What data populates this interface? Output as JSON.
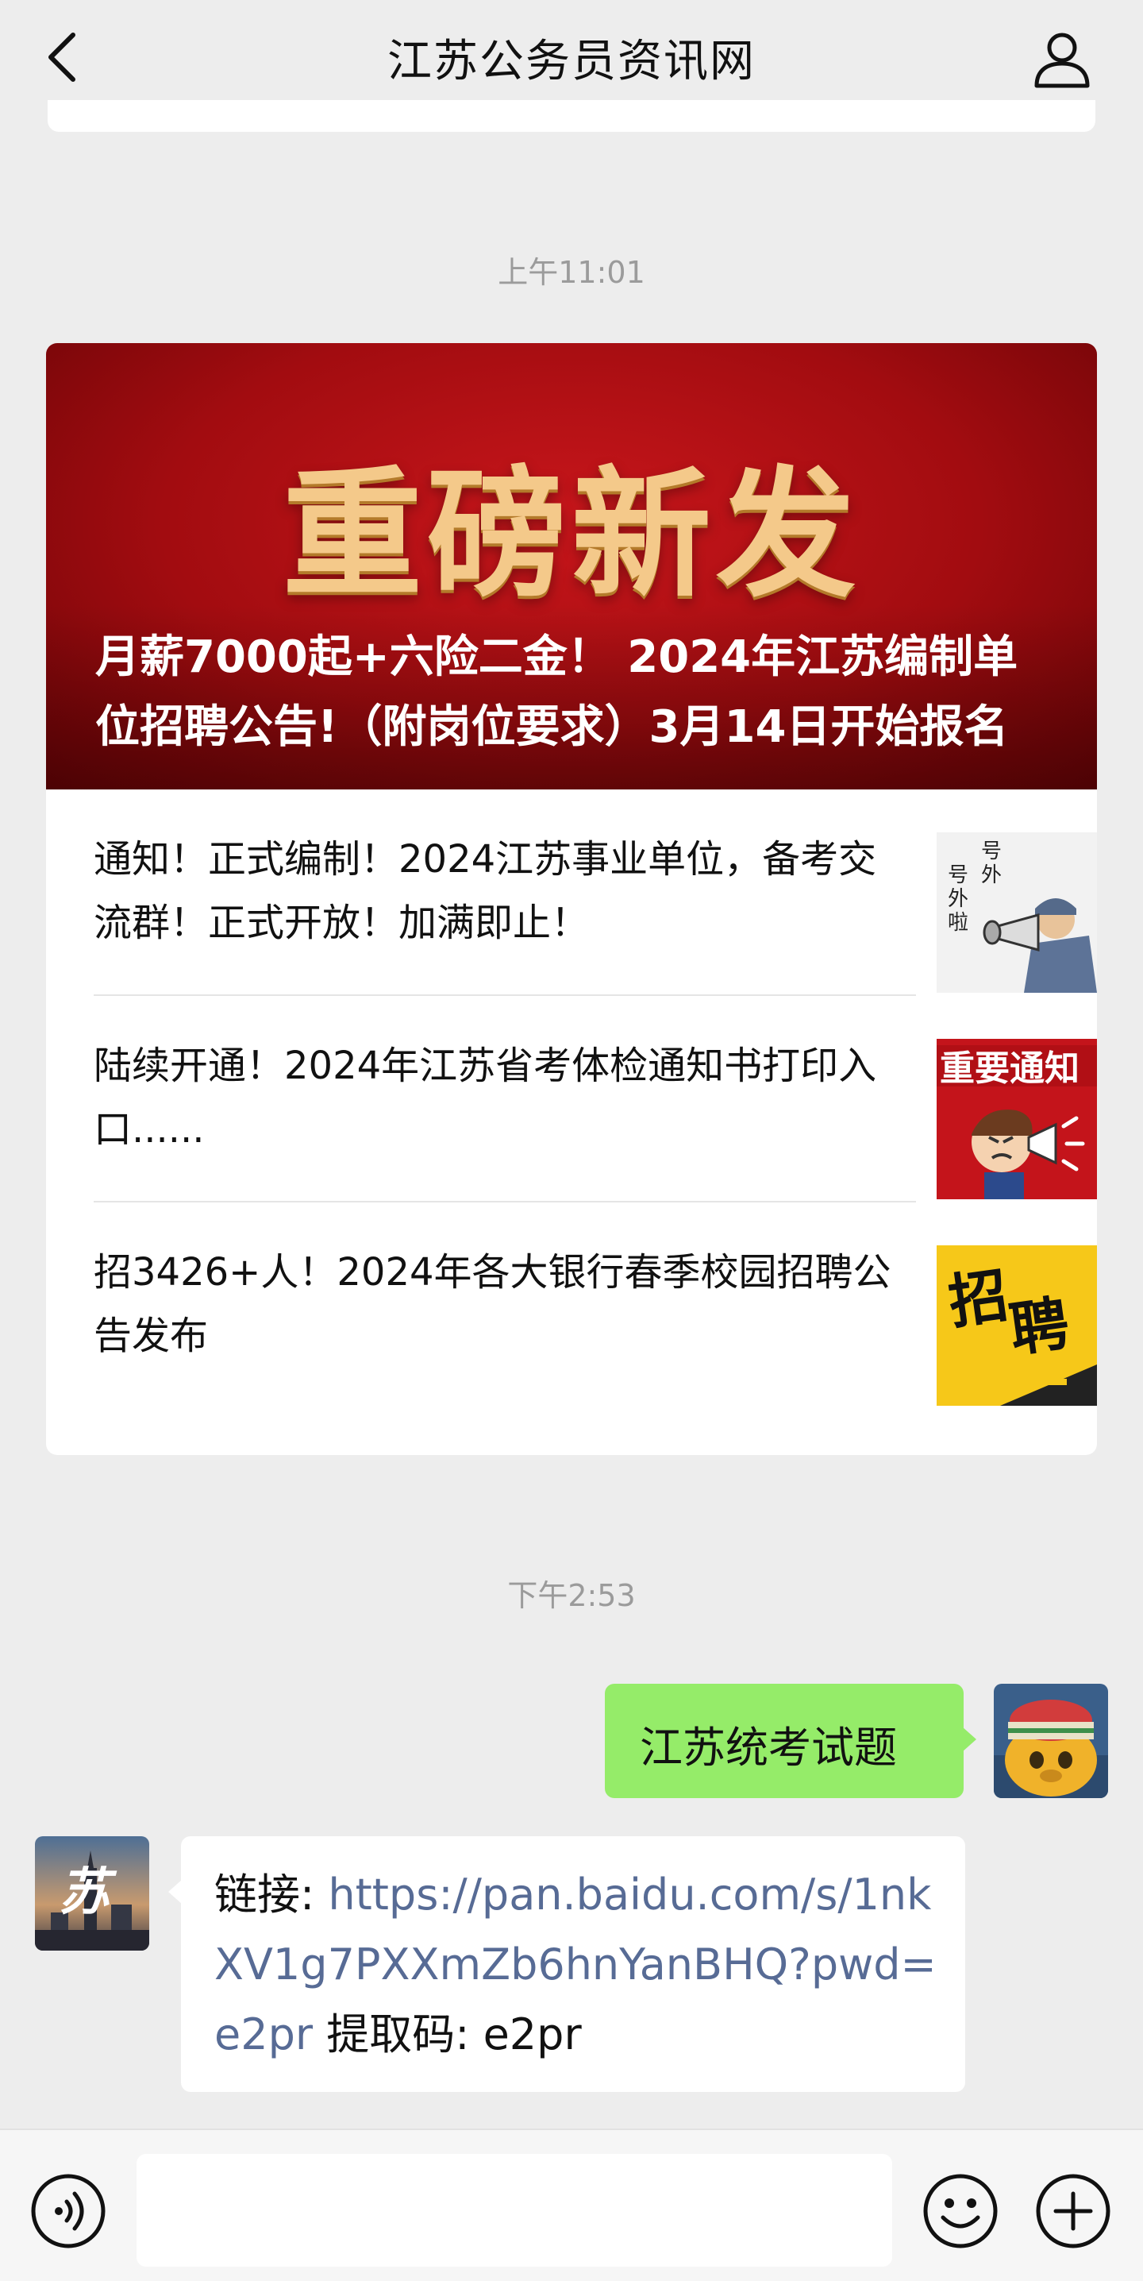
{
  "header": {
    "title": "江苏公务员资讯网",
    "back_icon": "chevron-left-icon",
    "profile_icon": "person-icon"
  },
  "timestamps": [
    "上午11:01",
    "下午2:53"
  ],
  "article_card": {
    "hero_banner": "重磅新发",
    "hero_title": "月薪7000起+六险二金！ 2024年江苏编制单位招聘公告!（附岗位要求）3月14日开始报名",
    "items": [
      {
        "text": "通知！正式编制！2024江苏事业单位，备考交流群！正式开放！加满即止！"
      },
      {
        "text": "陆续开通！2024年江苏省考体检通知书打印入口......"
      },
      {
        "text": "招3426+人！2024年各大银行春季校园招聘公告发布"
      }
    ]
  },
  "messages": {
    "sent_text": "江苏统考试题",
    "received": {
      "prefix": "链接: ",
      "link": "https://pan.baidu.com/s/1nkXV1g7PXXmZb6hnYanBHQ?pwd=e2pr",
      "suffix": " 提取码: e2pr"
    }
  },
  "colors": {
    "background": "#ededed",
    "sent_bubble": "#95ec69",
    "link": "#576b95",
    "hero_red": "#b3080e",
    "hero_gold": "#f4c98a"
  },
  "input_bar": {
    "voice_icon": "voice-icon",
    "emoji_icon": "emoji-icon",
    "plus_icon": "plus-circle-icon"
  }
}
